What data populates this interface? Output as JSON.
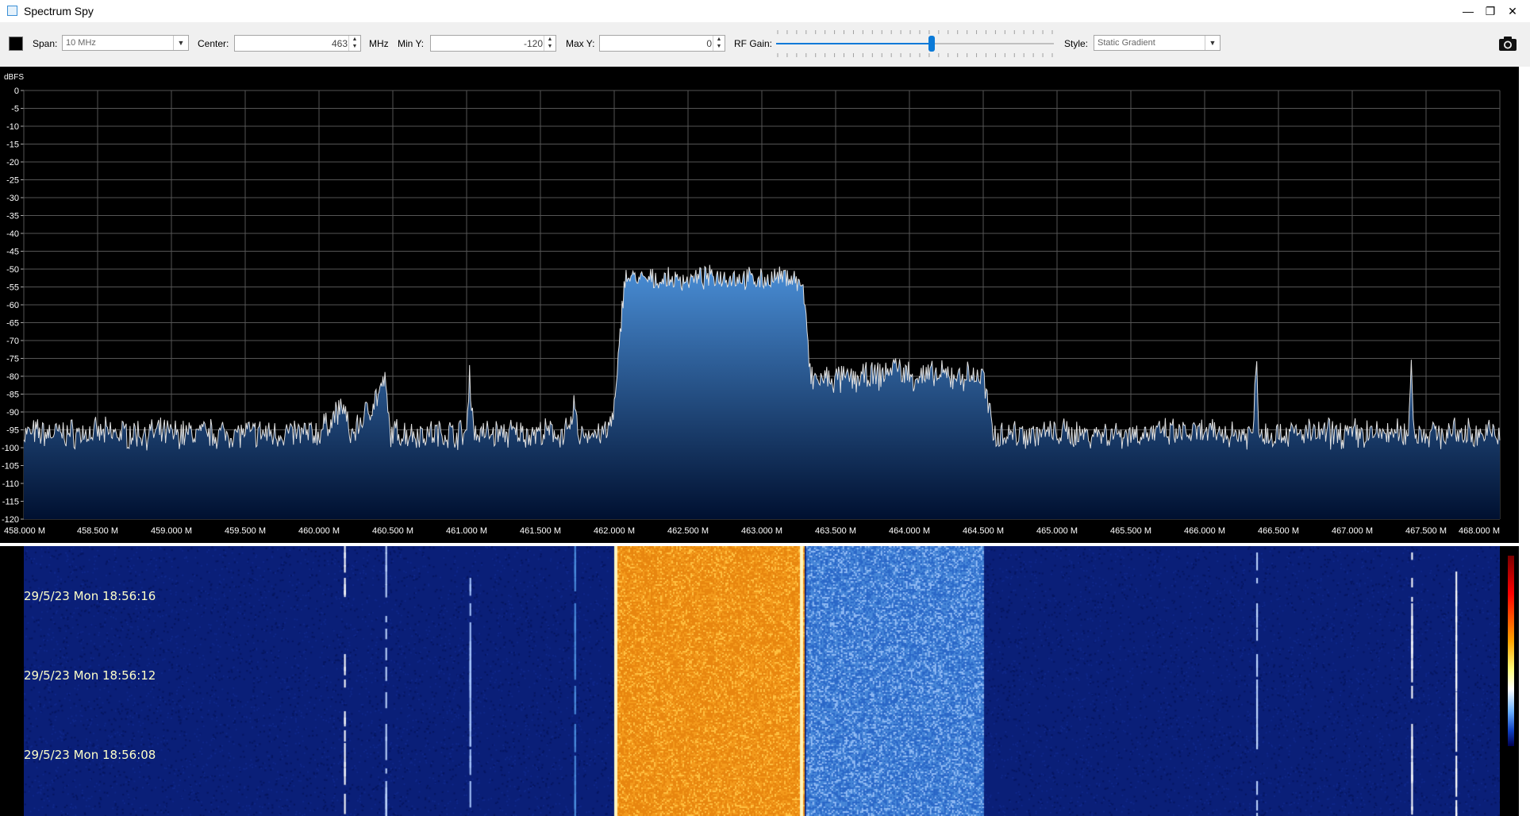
{
  "window": {
    "title": "Spectrum Spy",
    "minimize": "—",
    "restore": "❐",
    "close": "✕"
  },
  "toolbar": {
    "span_label": "Span:",
    "span_value": "10 MHz",
    "center_label": "Center:",
    "center_value": "463",
    "center_unit": "MHz",
    "min_y_label": "Min Y:",
    "min_y_value": "-120",
    "max_y_label": "Max Y:",
    "max_y_value": "0",
    "rf_gain_label": "RF Gain:",
    "rf_gain_level": 0.56,
    "style_label": "Style:",
    "style_value": "Static Gradient",
    "swatch_color": "#000000"
  },
  "chart_data": {
    "type": "area",
    "ylabel": "dBFS",
    "ylim": [
      -120,
      0
    ],
    "xlim": [
      458.0,
      468.0
    ],
    "y_ticks": [
      "0",
      "-5",
      "-10",
      "-15",
      "-20",
      "-25",
      "-30",
      "-35",
      "-40",
      "-45",
      "-50",
      "-55",
      "-60",
      "-65",
      "-70",
      "-75",
      "-80",
      "-85",
      "-90",
      "-95",
      "-100",
      "-105",
      "-110",
      "-115",
      "-120"
    ],
    "x_ticks": [
      "458.000 M",
      "458.500 M",
      "459.000 M",
      "459.500 M",
      "460.000 M",
      "460.500 M",
      "461.000 M",
      "461.500 M",
      "462.000 M",
      "462.500 M",
      "463.000 M",
      "463.500 M",
      "464.000 M",
      "464.500 M",
      "465.000 M",
      "465.500 M",
      "466.000 M",
      "466.500 M",
      "467.000 M",
      "467.500 M",
      "468.000 M"
    ],
    "grid": true,
    "series": [
      {
        "x": [
          458.0,
          458.5,
          459.0,
          459.5,
          460.0,
          460.17,
          460.2,
          460.23,
          460.45,
          460.48,
          460.5,
          461.0,
          461.02,
          461.05,
          461.5,
          461.7,
          461.73,
          461.75,
          461.95,
          462.0,
          462.03,
          462.07,
          462.2,
          462.5,
          462.7,
          463.0,
          463.2,
          463.28,
          463.3,
          463.33,
          463.5,
          463.8,
          463.9,
          464.0,
          464.3,
          464.5,
          464.53,
          464.57,
          465.0,
          465.5,
          466.0,
          466.33,
          466.35,
          466.37,
          466.5,
          467.0,
          467.38,
          467.4,
          467.42,
          467.7,
          468.0
        ],
        "y": [
          -96,
          -96,
          -96,
          -96,
          -96,
          -88,
          -96,
          -96,
          -82,
          -96,
          -96,
          -96,
          -79,
          -96,
          -96,
          -96,
          -87,
          -96,
          -96,
          -90,
          -75,
          -52,
          -53,
          -53,
          -52,
          -53,
          -52,
          -55,
          -65,
          -81,
          -81,
          -80,
          -77,
          -80,
          -80,
          -80,
          -88,
          -96,
          -96,
          -96,
          -96,
          -96,
          -73,
          -96,
          -96,
          -96,
          -96,
          -76,
          -96,
          -96,
          -96
        ]
      }
    ],
    "colors": {
      "trace": "#e0e0e0",
      "fill_top": "#4a8fd8",
      "fill_bottom": "#001030",
      "grid": "#555555"
    }
  },
  "waterfall": {
    "timestamps": [
      "29/5/23 Mon 18:56:16",
      "29/5/23 Mon 18:56:12",
      "29/5/23 Mon 18:56:08"
    ],
    "colors": {
      "background": "#0a1f78",
      "strong": "#f39a1c",
      "medium": "#4c8fe0"
    }
  }
}
